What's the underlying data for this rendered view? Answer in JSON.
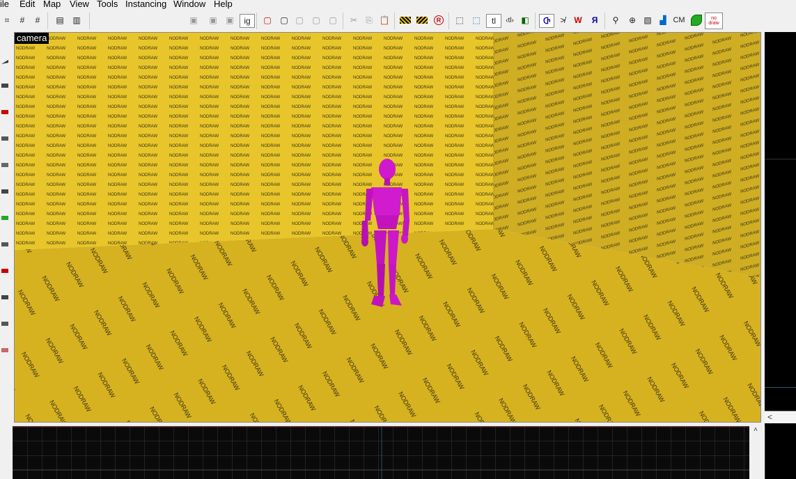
{
  "menu": [
    "ile",
    "Edit",
    "Map",
    "View",
    "Tools",
    "Instancing",
    "Window",
    "Help"
  ],
  "toolbar": {
    "ig_label": "ig",
    "tl_label": "tl",
    "tl_arrow_label": "‹tl›",
    "cm_label": "CM",
    "nodraw_label": "no draw",
    "r_label": "R"
  },
  "viewport": {
    "label": "camera",
    "texture_text": "NODRAW",
    "wall_color": "#e6c52a",
    "floor_color": "#d4b020",
    "right_wall_color": "#cfac22",
    "figure_color": "#cc10c8"
  },
  "side": {
    "collapse_label": "<"
  },
  "scroll": {
    "up_label": "˄"
  }
}
